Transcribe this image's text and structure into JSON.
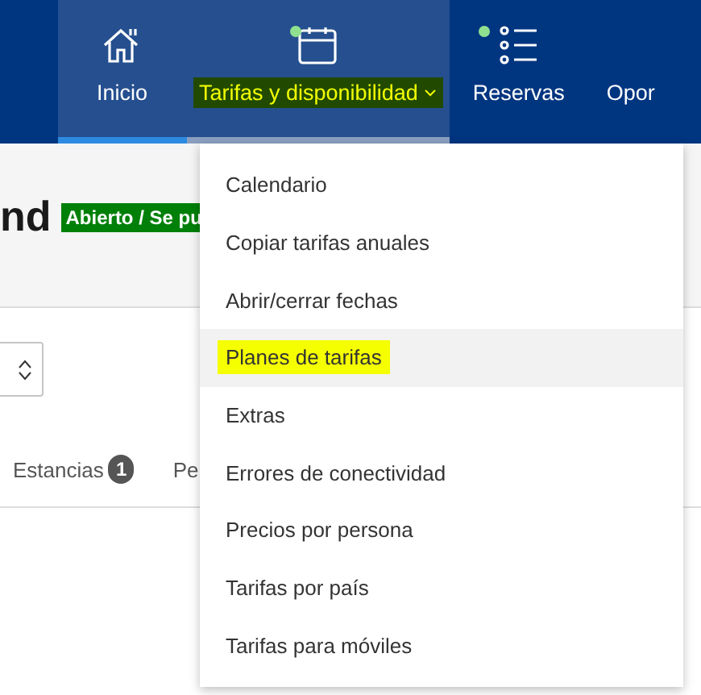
{
  "nav": {
    "items": [
      {
        "label": "Inicio",
        "active": true,
        "dot": false,
        "dropdown": false,
        "highlighted": false
      },
      {
        "label": "Tarifas y disponibilidad",
        "active": false,
        "open": true,
        "dot": true,
        "dropdown": true,
        "highlighted": true
      },
      {
        "label": "Reservas",
        "active": false,
        "dot": true,
        "dropdown": false,
        "highlighted": false
      },
      {
        "label": "Opor",
        "active": false,
        "dot": false,
        "dropdown": false,
        "highlighted": false
      }
    ]
  },
  "header": {
    "title": "nd",
    "status": "Abierto / Se pu"
  },
  "tabs": [
    {
      "label": "Estancias",
      "count": "1"
    },
    {
      "label": "Pe"
    }
  ],
  "menu": {
    "items": [
      {
        "label": "Calendario",
        "selected": false,
        "highlighted": false
      },
      {
        "label": "Copiar tarifas anuales",
        "selected": false,
        "highlighted": false
      },
      {
        "label": "Abrir/cerrar fechas",
        "selected": false,
        "highlighted": false
      },
      {
        "label": "Planes de tarifas",
        "selected": true,
        "highlighted": true
      },
      {
        "label": "Extras",
        "selected": false,
        "highlighted": false
      },
      {
        "label": "Errores de conectividad",
        "selected": false,
        "highlighted": false
      },
      {
        "label": "Precios por persona",
        "selected": false,
        "highlighted": false
      },
      {
        "label": "Tarifas por país",
        "selected": false,
        "highlighted": false
      },
      {
        "label": "Tarifas para móviles",
        "selected": false,
        "highlighted": false
      }
    ]
  }
}
